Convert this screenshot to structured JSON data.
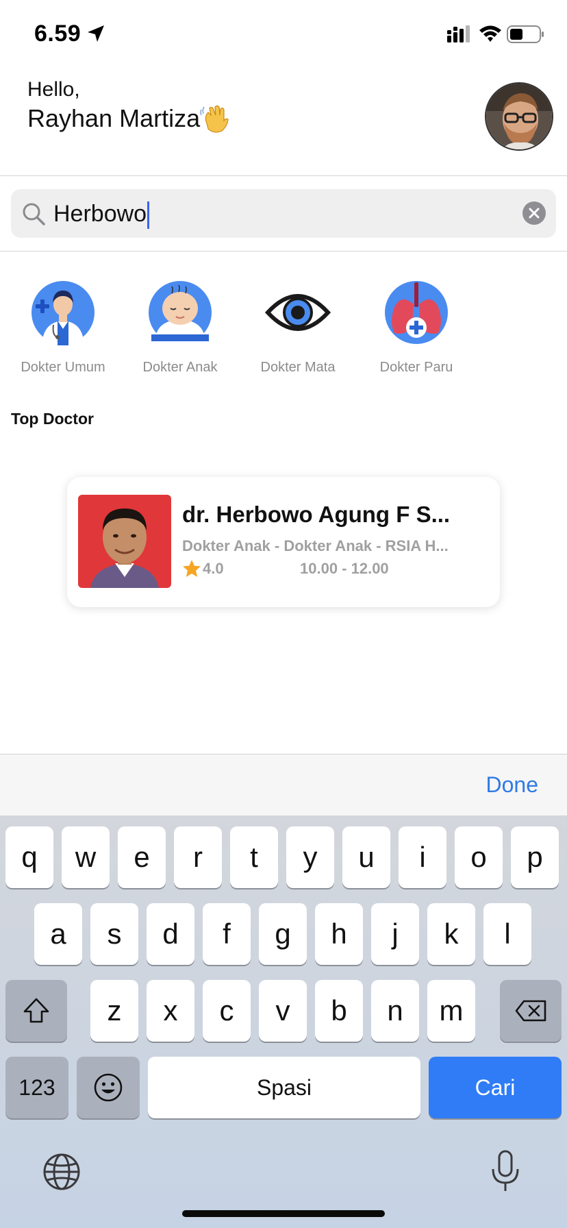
{
  "status_bar": {
    "time": "6.59"
  },
  "header": {
    "greeting": "Hello,",
    "user_name": "Rayhan Martiza"
  },
  "search": {
    "value": "Herbowo"
  },
  "categories": [
    {
      "label": "Dokter Umum",
      "icon": "general-doctor-icon"
    },
    {
      "label": "Dokter Anak",
      "icon": "pediatrician-icon"
    },
    {
      "label": "Dokter Mata",
      "icon": "eye-icon"
    },
    {
      "label": "Dokter Paru",
      "icon": "lungs-icon"
    }
  ],
  "section": {
    "title": "Top Doctor"
  },
  "doctor": {
    "name": "dr. Herbowo Agung F S...",
    "specialty": "Dokter Anak - Dokter Anak - RSIA H...",
    "rating": "4.0",
    "hours": "10.00 - 12.00"
  },
  "keyboard": {
    "done_label": "Done",
    "row1": [
      "q",
      "w",
      "e",
      "r",
      "t",
      "y",
      "u",
      "i",
      "o",
      "p"
    ],
    "row2": [
      "a",
      "s",
      "d",
      "f",
      "g",
      "h",
      "j",
      "k",
      "l"
    ],
    "row3": [
      "z",
      "x",
      "c",
      "v",
      "b",
      "n",
      "m"
    ],
    "numbers_label": "123",
    "space_label": "Spasi",
    "search_label": "Cari"
  },
  "colors": {
    "accent_blue": "#2f7cf6",
    "caret": "#3a63f3",
    "star": "#f5a623",
    "muted_text": "#a0a0a0"
  }
}
